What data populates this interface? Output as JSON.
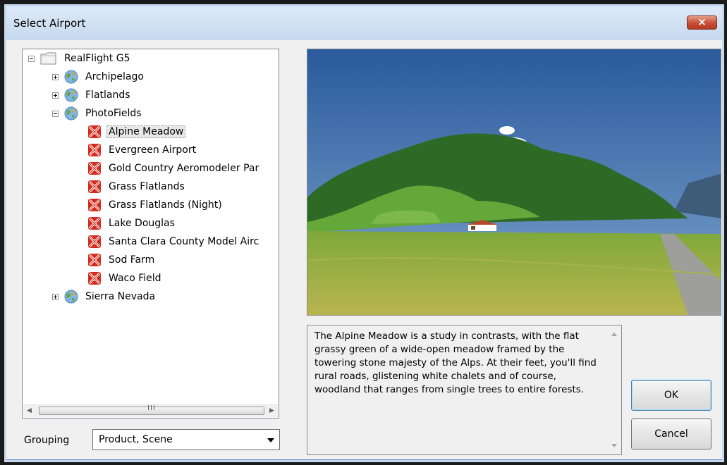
{
  "window": {
    "title": "Select Airport",
    "close_glyph": "×"
  },
  "tree": {
    "root": {
      "label": "RealFlight G5",
      "icon": "folder-icon"
    },
    "groups": [
      {
        "label": "Archipelago",
        "icon": "globe-icon",
        "expanded": false
      },
      {
        "label": "Flatlands",
        "icon": "globe-icon",
        "expanded": false
      },
      {
        "label": "PhotoFields",
        "icon": "globe-icon",
        "expanded": true
      },
      {
        "label": "Sierra Nevada",
        "icon": "globe-icon",
        "expanded": false
      }
    ],
    "photofields_items": [
      {
        "label": "Alpine Meadow",
        "selected": true
      },
      {
        "label": "Evergreen Airport"
      },
      {
        "label": "Gold Country Aeromodeler Par"
      },
      {
        "label": "Grass Flatlands"
      },
      {
        "label": "Grass Flatlands (Night)"
      },
      {
        "label": "Lake Douglas"
      },
      {
        "label": "Santa Clara County Model Airc"
      },
      {
        "label": "Sod Farm"
      },
      {
        "label": "Waco Field"
      }
    ],
    "scroll_thumb_grip": "III"
  },
  "grouping": {
    "label": "Grouping",
    "value": "Product, Scene"
  },
  "description": "The Alpine Meadow is a study in contrasts, with the flat grassy green of a wide-open meadow framed by the towering stone majesty of the Alps. At their feet, you'll find rural roads, glistening white chalets and of course, woodland that ranges from single trees to entire forests.",
  "buttons": {
    "ok": "OK",
    "cancel": "Cancel"
  },
  "colors": {
    "selection": "#e8e8e8",
    "title_gradient_top": "#dde9f7",
    "close_red": "#c9523a"
  }
}
